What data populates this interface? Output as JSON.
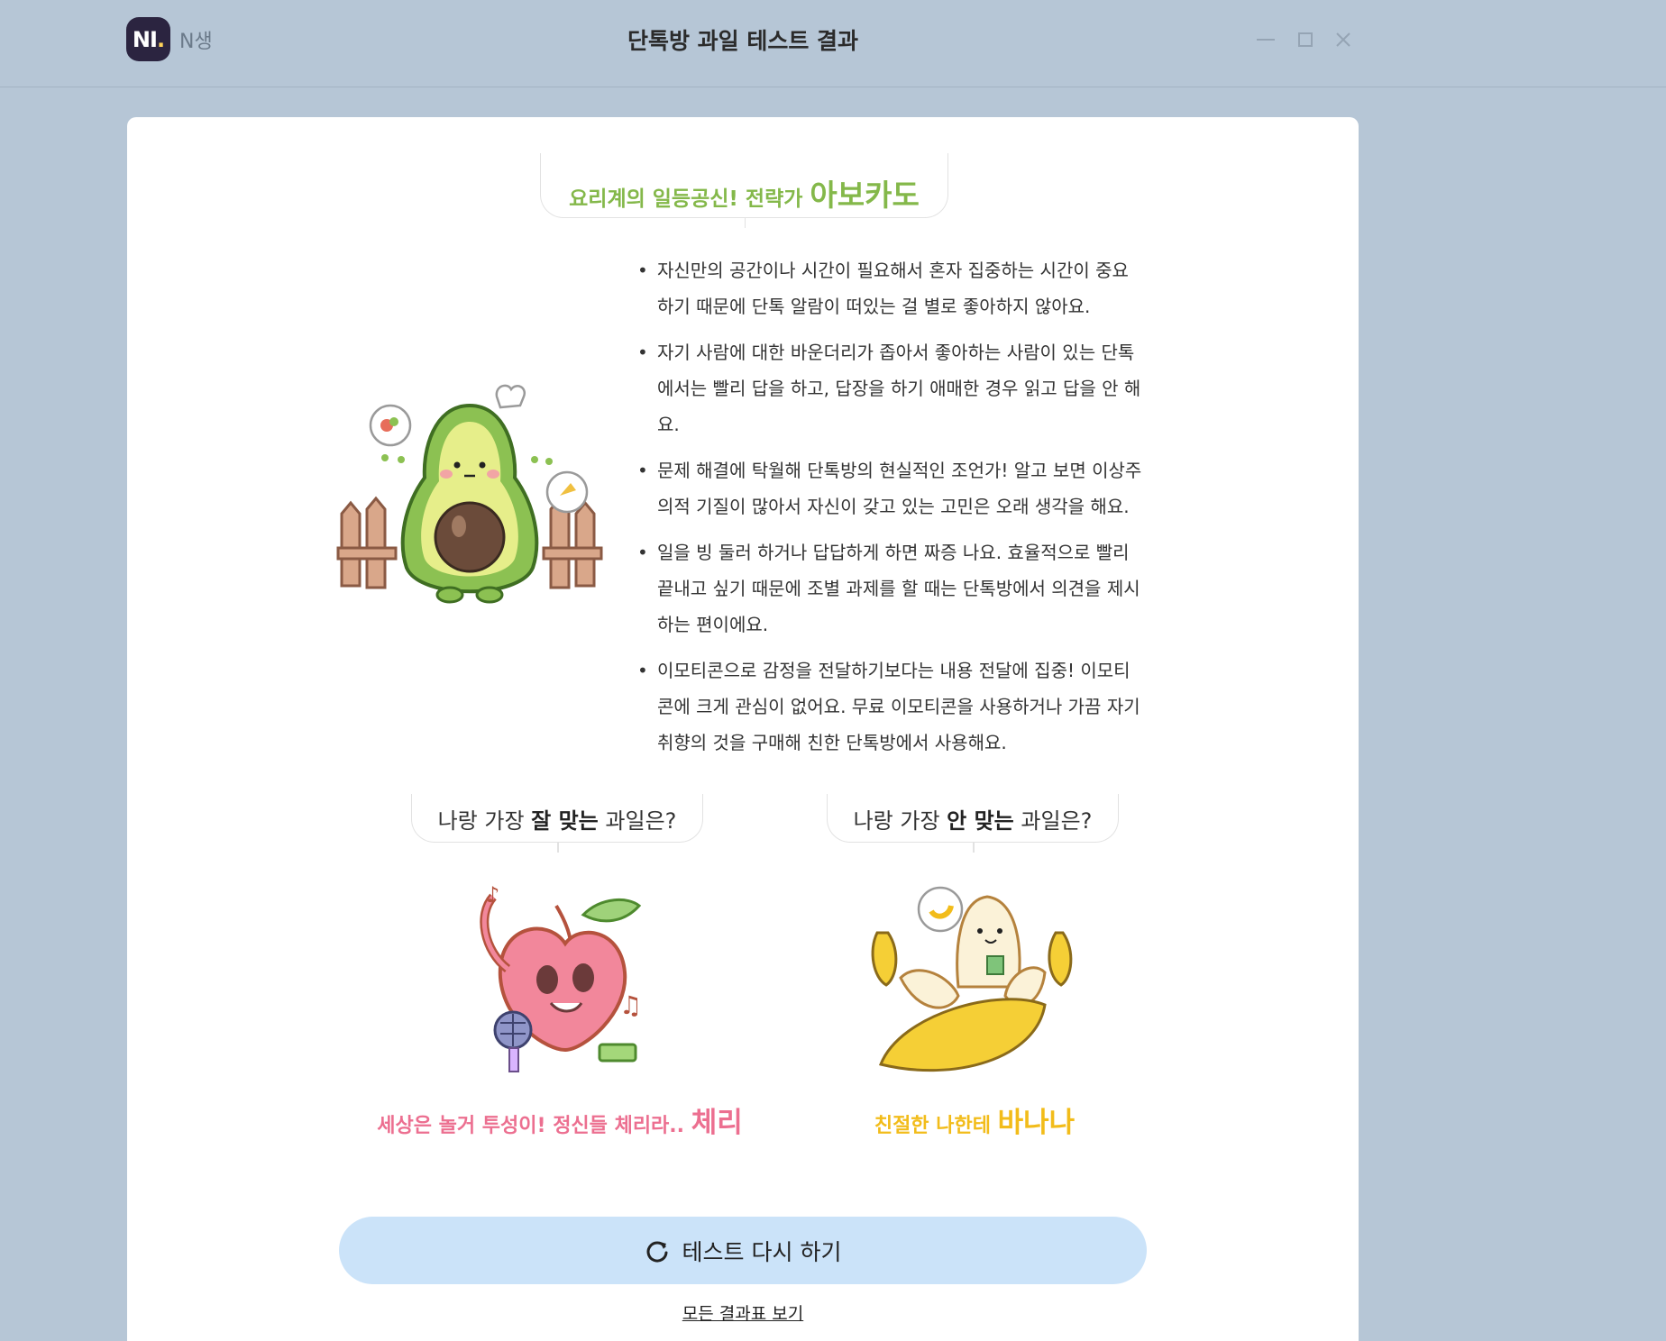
{
  "window": {
    "app_name": "N생",
    "logo_text": "NI",
    "logo_dot": ".",
    "title": "단톡방 과일 테스트 결과"
  },
  "result": {
    "subtitle": "요리계의 일등공신! 전략가",
    "name": "아보카도",
    "accent_color": "#84b84a",
    "traits": [
      "자신만의 공간이나 시간이 필요해서 혼자 집중하는 시간이 중요하기 때문에 단톡 알람이 떠있는 걸 별로 좋아하지 않아요.",
      "자기 사람에 대한 바운더리가 좁아서 좋아하는 사람이 있는 단톡에서는 빨리 답을 하고, 답장을 하기 애매한 경우 읽고 답을 안 해요.",
      "문제 해결에 탁월해 단톡방의 현실적인 조언가! 알고 보면 이상주의적 기질이 많아서 자신이 갖고 있는 고민은 오래 생각을 해요.",
      "일을 빙 둘러 하거나 답답하게 하면 짜증 나요. 효율적으로 빨리 끝내고 싶기 때문에 조별 과제를 할 때는 단톡방에서 의견을 제시하는 편이에요.",
      "이모티콘으로 감정을 전달하기보다는 내용 전달에 집중! 이모티콘에 크게 관심이 없어요. 무료 이모티콘을 사용하거나 가끔 자기 취향의 것을 구매해 친한 단톡방에서 사용해요."
    ]
  },
  "good_match": {
    "question_pre": "나랑 가장",
    "question_em": "잘 맞는",
    "question_post": "과일은?",
    "subtitle": "세상은 놀거 투성이! 정신들 체리라..",
    "name": "체리",
    "color": "#ec6f90"
  },
  "bad_match": {
    "question_pre": "나랑 가장",
    "question_em": "안 맞는",
    "question_post": "과일은?",
    "subtitle": "친절한 나한테",
    "name": "바나나",
    "color": "#f2bc1a"
  },
  "actions": {
    "retry_label": "테스트 다시 하기",
    "all_results_label": "모든 결과표 보기"
  },
  "icons": {
    "retry": "refresh-icon",
    "minimize": "minimize-icon",
    "maximize": "maximize-icon",
    "close": "close-icon"
  }
}
